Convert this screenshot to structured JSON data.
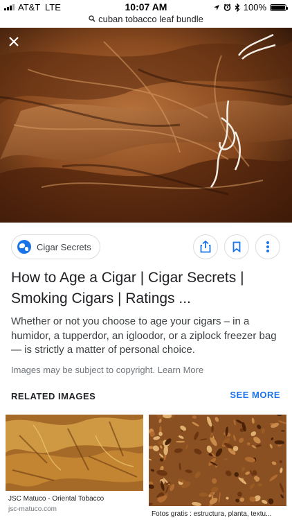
{
  "status_bar": {
    "carrier": "AT&T",
    "network": "LTE",
    "time": "10:07 AM",
    "battery": "100%",
    "battery_level": 1.0
  },
  "url_bar": {
    "query": "cuban tobacco leaf bundle"
  },
  "source": {
    "name": "Cigar Secrets"
  },
  "result": {
    "title": "How to Age a Cigar | Cigar Secrets | Smoking Cigars | Ratings ...",
    "description": "Whether or not you choose to age your cigars – in a humidor, a tupperdor, an igloodor, or a ziplock freezer bag — is strictly a matter of personal choice.",
    "copyright": "Images may be subject to copyright. Learn More"
  },
  "related": {
    "heading": "RELATED IMAGES",
    "see_more": "SEE MORE",
    "items": [
      {
        "caption": "JSC Matuco - Oriental Tobacco",
        "site": "jsc-matuco.com"
      },
      {
        "caption": "Fotos gratis : estructura, planta, textu...",
        "site": ""
      }
    ]
  },
  "colors": {
    "accent": "#1a73e8",
    "text": "#202124",
    "muted": "#70757a",
    "border": "#dadce0"
  },
  "icons": [
    "signal-icon",
    "location-arrow-icon",
    "alarm-icon",
    "bluetooth-icon",
    "battery-icon",
    "search-icon",
    "close-icon",
    "globe-icon",
    "share-icon",
    "bookmark-icon",
    "more-vert-icon"
  ]
}
